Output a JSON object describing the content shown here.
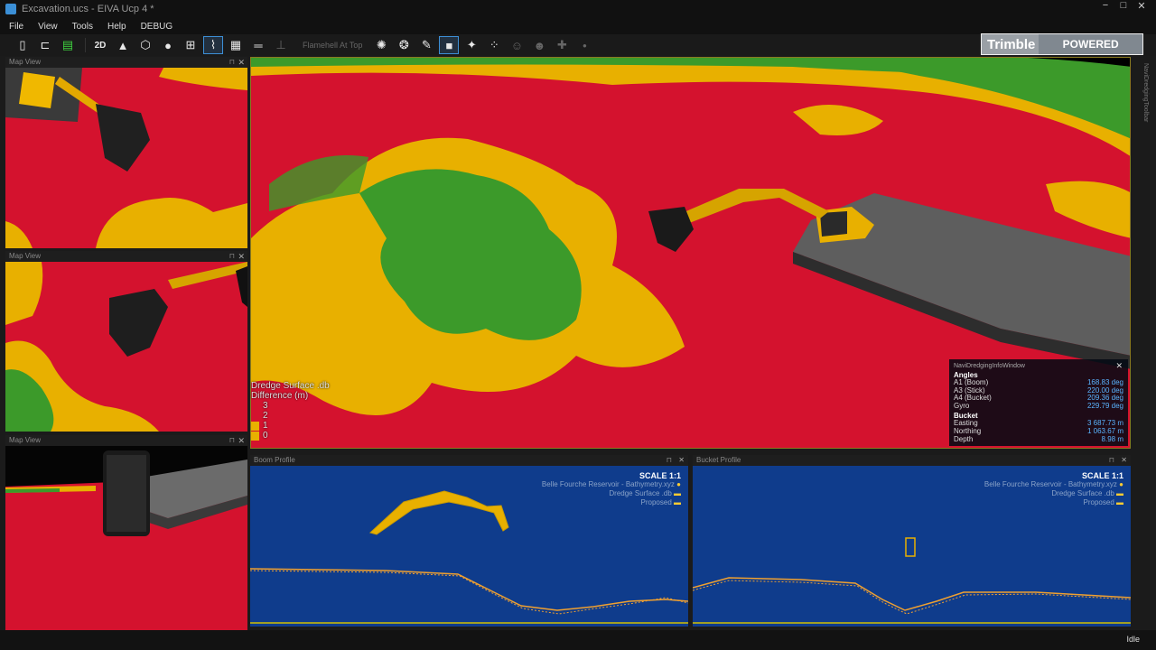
{
  "window": {
    "title": "Excavation.ucs - EIVA Ucp 4 *",
    "min": "−",
    "max": "□",
    "close": "✕"
  },
  "menu": [
    "File",
    "View",
    "Tools",
    "Help",
    "DEBUG"
  ],
  "toolbar": {
    "two_d_label": "2D",
    "camera_label": "Flamehell At Top"
  },
  "logo": {
    "brand": "Trimble",
    "tag": "POWERED"
  },
  "side_tab": "NaviDredgingToolbar",
  "panels": {
    "map1": "Map View",
    "map2": "Map View",
    "map3": "Map View",
    "pin": "⊓",
    "close": "✕"
  },
  "legend": {
    "title": "Dredge Surface .db",
    "subtitle": "Difference (m)",
    "items": [
      {
        "label": "3",
        "color": "#d4122e"
      },
      {
        "label": "2",
        "color": "#d4122e"
      },
      {
        "label": "1",
        "color": "#e8b000"
      },
      {
        "label": "0",
        "color": "#e8b000"
      }
    ]
  },
  "info": {
    "header": "NaviDredgingInfoWindow",
    "close": "✕",
    "angles_label": "Angles",
    "angles": [
      {
        "name": "A1 (Boom)",
        "value": "168.83 deg"
      },
      {
        "name": "A3 (Stick)",
        "value": "220.00 deg"
      },
      {
        "name": "A4 (Bucket)",
        "value": "209.36 deg"
      },
      {
        "name": "Gyro",
        "value": "229.79 deg"
      }
    ],
    "bucket_label": "Bucket",
    "bucket": [
      {
        "name": "Easting",
        "value": "3 687.73 m"
      },
      {
        "name": "Northing",
        "value": "1 063.67 m"
      },
      {
        "name": "Depth",
        "value": "8.98 m"
      }
    ]
  },
  "boom_profile": {
    "title": "Boom Profile",
    "scale": "SCALE 1:1",
    "layers": [
      "Belle Fourche Reservoir - Bathymetry.xyz",
      "Dredge Surface .db",
      "Proposed"
    ]
  },
  "bucket_profile": {
    "title": "Bucket Profile",
    "scale": "SCALE 1:1",
    "layers": [
      "Belle Fourche Reservoir - Bathymetry.xyz",
      "Dredge Surface .db",
      "Proposed"
    ]
  },
  "status": "Idle",
  "colors": {
    "red": "#d4122e",
    "yellow": "#e8b000",
    "green": "#3c9a2a",
    "profile_bg": "#0f3c8c",
    "profile_line": "#f0a030",
    "accent": "#3d8fd6"
  }
}
